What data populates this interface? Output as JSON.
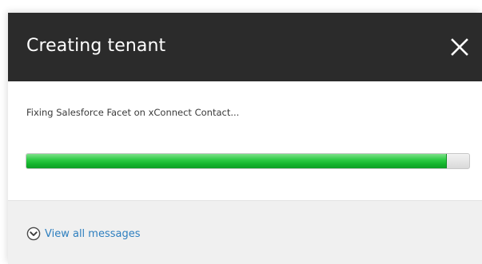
{
  "dialog": {
    "title": "Creating tenant",
    "close_icon": "close-icon"
  },
  "body": {
    "message": "Fixing Salesforce Facet on xConnect Contact...",
    "progress_percent": 95
  },
  "footer": {
    "view_all_label": "View all messages",
    "view_all_icon": "chevron-down-circle-icon"
  },
  "colors": {
    "titlebar_bg": "#2b2b2b",
    "progress_green": "#1fc238",
    "link_blue": "#2e7fbf",
    "footer_bg": "#f0f0f0"
  }
}
